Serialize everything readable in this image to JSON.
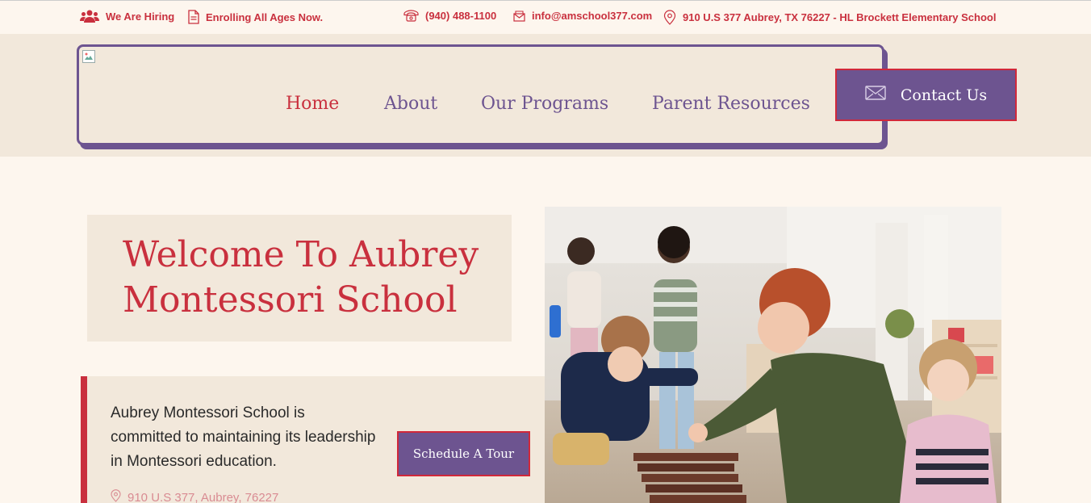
{
  "topbar": {
    "hiring": {
      "label": "We Are Hiring",
      "icon": "users-icon"
    },
    "enrolling": {
      "label": "Enrolling All Ages Now.",
      "icon": "document-icon"
    },
    "phone": {
      "label": "(940) 488-1100",
      "icon": "phone-icon"
    },
    "email": {
      "label": "info@amschool377.com",
      "icon": "mail-icon"
    },
    "address": {
      "label": "910 U.S 377 Aubrey, TX 76227 - HL Brockett Elementary School",
      "icon": "location-pin-icon"
    }
  },
  "nav": {
    "items": [
      {
        "label": "Home",
        "active": true
      },
      {
        "label": "About",
        "active": false
      },
      {
        "label": "Our Programs",
        "active": false
      },
      {
        "label": "Parent Resources",
        "active": false
      }
    ],
    "contact_label": "Contact Us"
  },
  "hero": {
    "title": "Welcome To Aubrey Montessori School",
    "description": "Aubrey Montessori School is committed to maintaining its leadership in Montessori education.",
    "tour_button": "Schedule A Tour",
    "address": "910 U.S 377, Aubrey, 76227"
  },
  "colors": {
    "accent_red": "#c9303e",
    "brand_purple": "#6d5490",
    "background": "#fdf6ee",
    "panel": "#f2e8db"
  }
}
